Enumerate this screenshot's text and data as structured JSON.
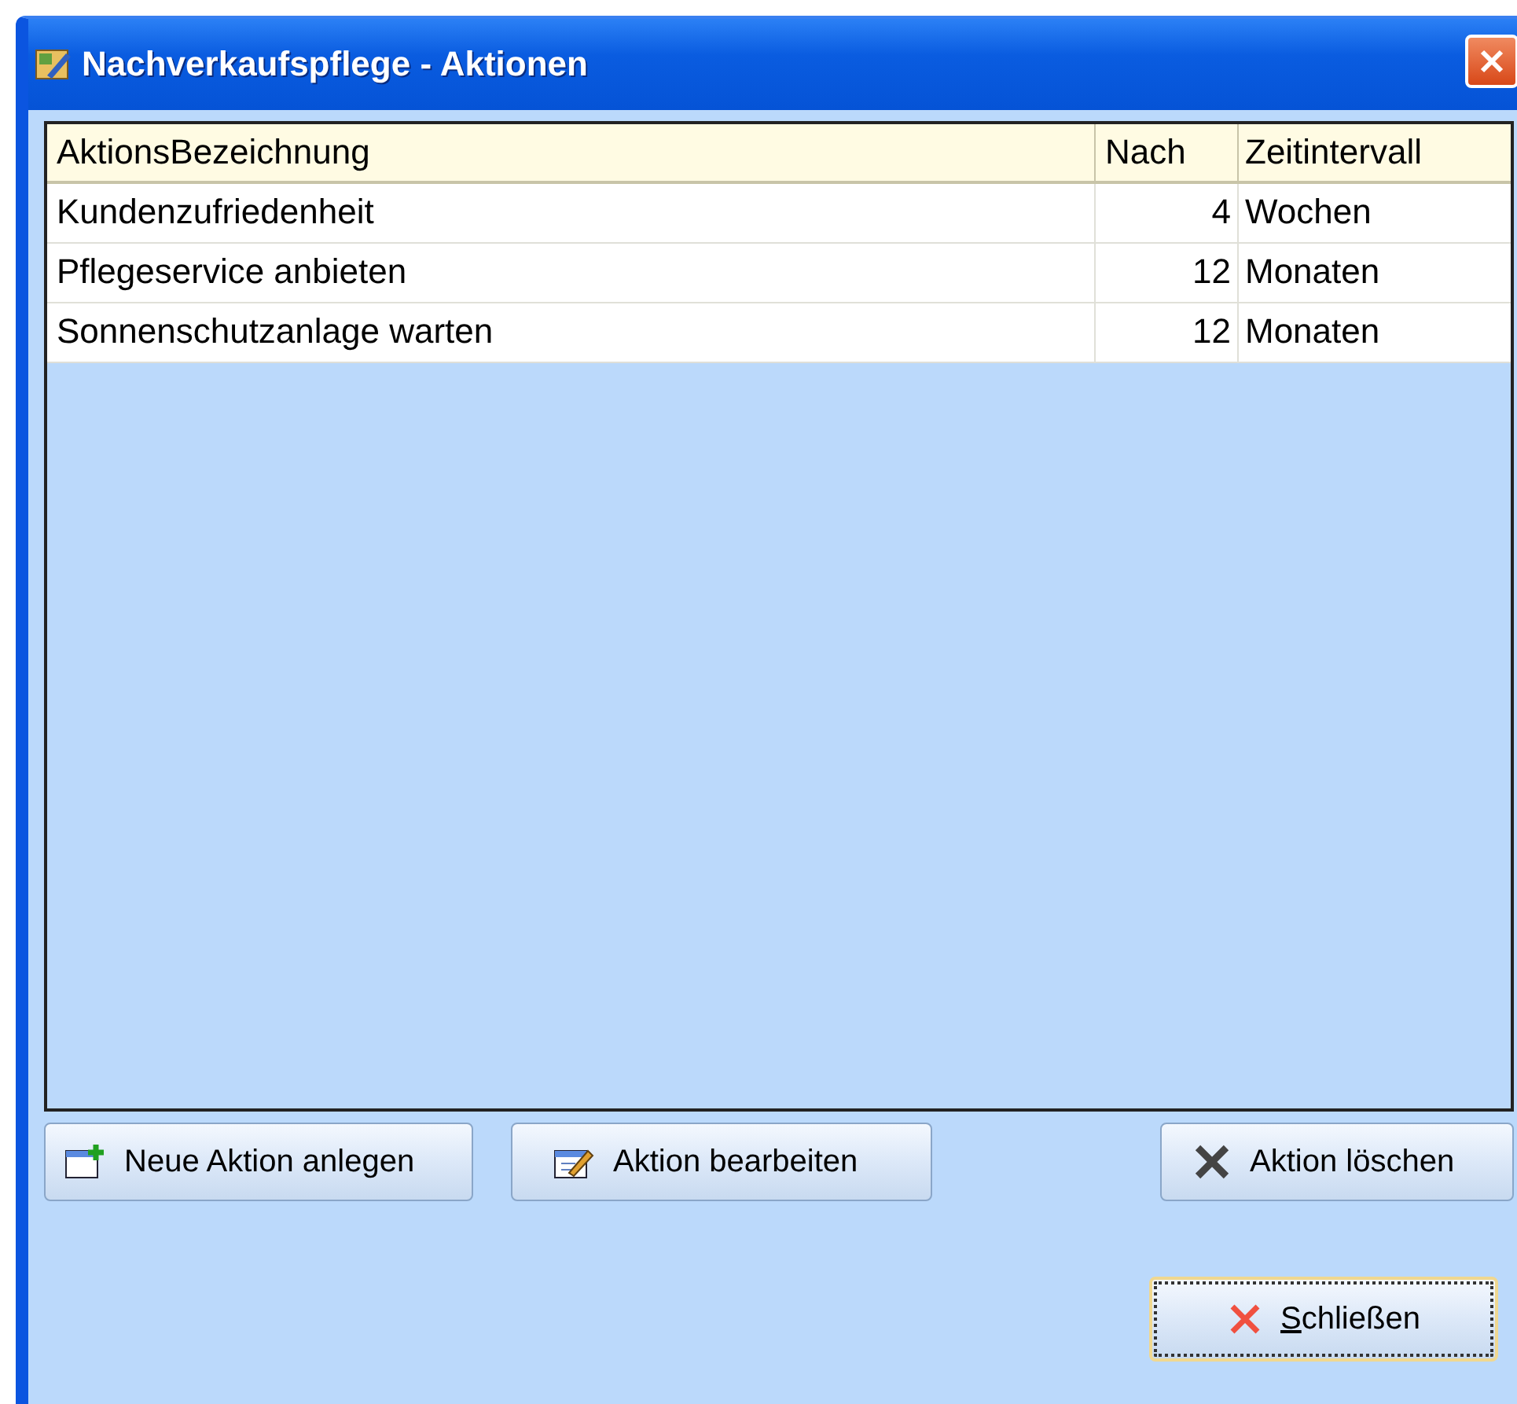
{
  "window": {
    "title": "Nachverkaufspflege - Aktionen"
  },
  "table": {
    "columns": [
      "AktionsBezeichnung",
      "Nach",
      "Zeitintervall"
    ],
    "rows": [
      {
        "name": "Kundenzufriedenheit",
        "after": "4",
        "interval": "Wochen"
      },
      {
        "name": "Pflegeservice anbieten",
        "after": "12",
        "interval": "Monaten"
      },
      {
        "name": "Sonnenschutzanlage warten",
        "after": "12",
        "interval": "Monaten"
      }
    ]
  },
  "action_buttons": [
    "Neue Aktion anlegen",
    "Aktion bearbeiten",
    "Aktion löschen"
  ],
  "close_button": {
    "label": "Schließen",
    "focused": true
  }
}
